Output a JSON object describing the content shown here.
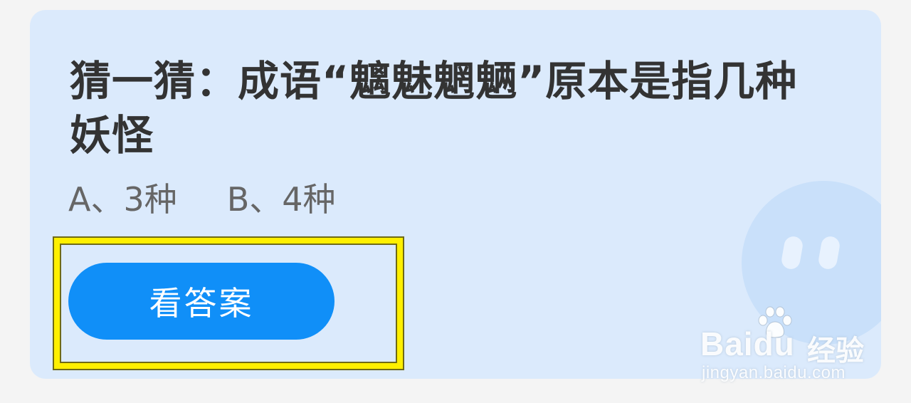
{
  "question": {
    "text": "猜一猜：成语“魑魅魍魉”原本是指几种妖怪"
  },
  "options": [
    {
      "label": "A、3种"
    },
    {
      "label": "B、4种"
    }
  ],
  "answer_button": {
    "label": "看答案"
  },
  "watermark": {
    "brand": "Baidu",
    "brand_cn": "经验",
    "site": "jingyan.baidu.com"
  },
  "colors": {
    "page_background": "#f4f4f4",
    "card_background": "#dbeafc",
    "button": "#108ff8",
    "highlight": "#fff000",
    "question_text": "#333333",
    "option_text": "#666666"
  }
}
